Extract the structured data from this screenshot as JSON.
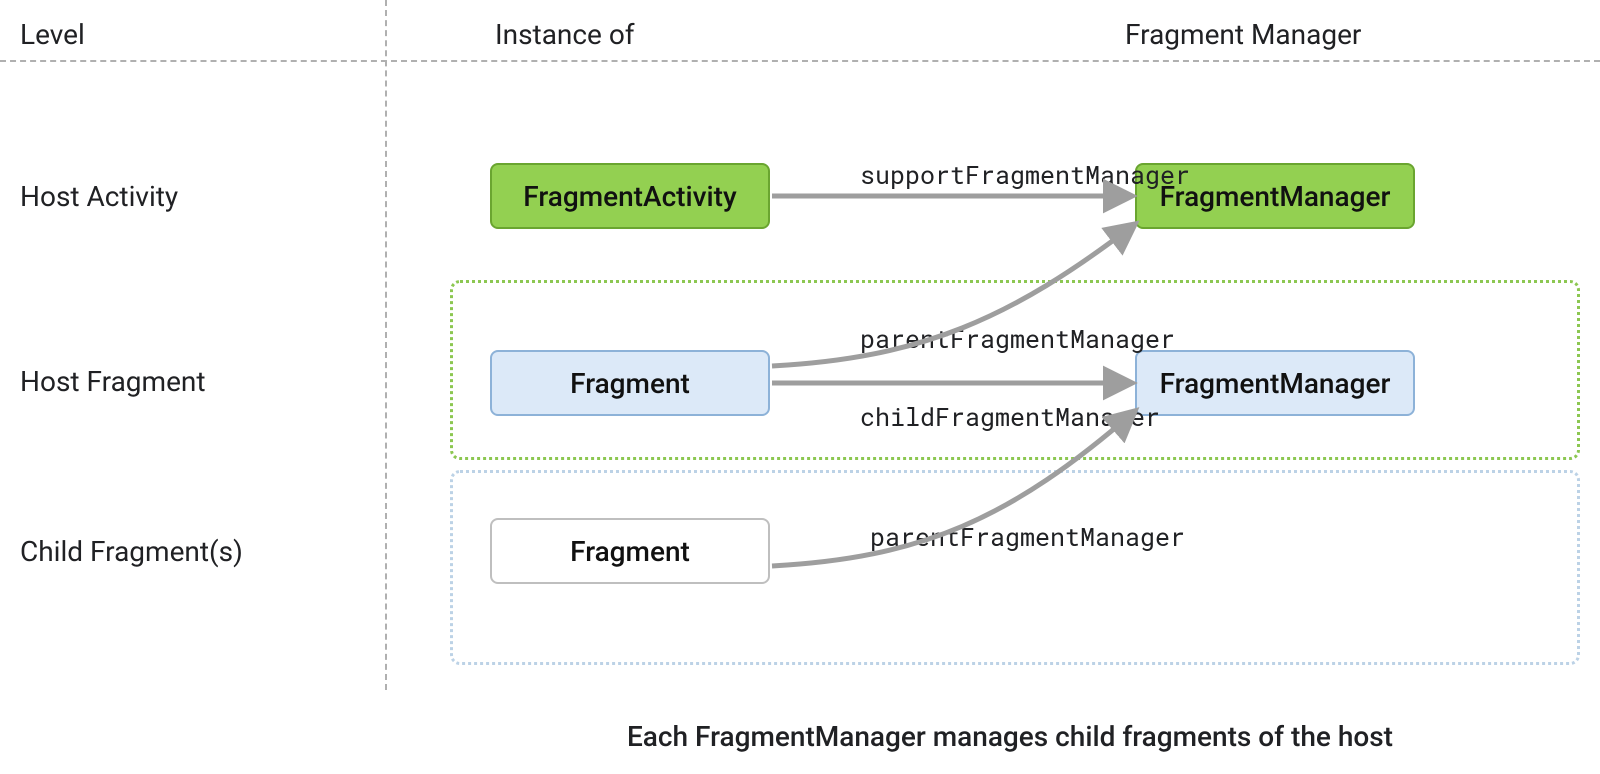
{
  "headers": {
    "level": "Level",
    "instance_of": "Instance of",
    "fragment_manager": "Fragment Manager"
  },
  "levels": {
    "host_activity": "Host Activity",
    "host_fragment": "Host Fragment",
    "child_fragments": "Child Fragment(s)"
  },
  "boxes": {
    "fragment_activity": "FragmentActivity",
    "fragment_manager_top": "FragmentManager",
    "fragment_mid": "Fragment",
    "fragment_manager_mid": "FragmentManager",
    "fragment_bottom": "Fragment"
  },
  "arrows": {
    "support_fm": "supportFragmentManager",
    "parent_fm_1": "parentFragmentManager",
    "child_fm": "childFragmentManager",
    "parent_fm_2": "parentFragmentManager"
  },
  "caption": "Each FragmentManager manages child fragments of the host",
  "colors": {
    "green_fill": "#93d051",
    "green_stroke": "#6aa530",
    "blue_fill": "#dce9f8",
    "blue_stroke": "#8db2d8",
    "grey_stroke": "#bfbfbf",
    "arrow": "#9e9e9e",
    "dashed": "#b0b0b0"
  }
}
